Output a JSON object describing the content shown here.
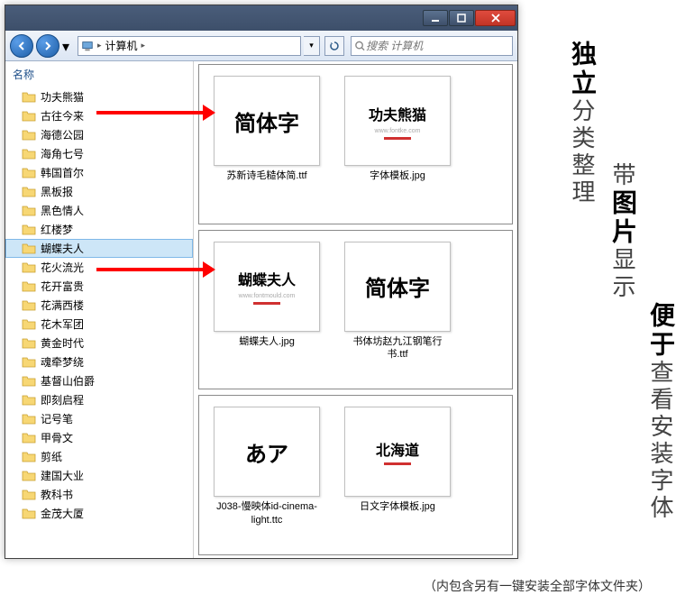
{
  "titlebar": {},
  "nav": {
    "address_icon": "computer-icon",
    "address_path": "计算机",
    "search_placeholder": "搜索 计算机"
  },
  "sidebar": {
    "header": "名称",
    "folders": [
      "功夫熊猫",
      "古往今来",
      "海德公园",
      "海角七号",
      "韩国首尔",
      "黑板报",
      "黑色情人",
      "红楼梦",
      "蝴蝶夫人",
      "花火流光",
      "花开富贵",
      "花满西楼",
      "花木军团",
      "黄金时代",
      "魂牵梦绕",
      "基督山伯爵",
      "即刻启程",
      "记号笔",
      "甲骨文",
      "剪纸",
      "建国大业",
      "教科书",
      "金茂大厦"
    ],
    "selected_index": 8
  },
  "panels": [
    {
      "thumbs": [
        {
          "main": "简体字",
          "sub": "",
          "label": "苏新诗毛糙体简.ttf"
        },
        {
          "main": "功夫熊猫",
          "sub": "www.fontke.com",
          "bar": true,
          "label": "字体模板.jpg",
          "small": true
        }
      ]
    },
    {
      "thumbs": [
        {
          "main": "蝴蝶夫人",
          "sub": "www.fontmould.com",
          "bar": true,
          "label": "蝴蝶夫人.jpg",
          "small": true
        },
        {
          "main": "简体字",
          "sub": "",
          "label": "书体坊赵九江钢笔行书.ttf"
        }
      ]
    },
    {
      "thumbs": [
        {
          "main": "あア",
          "sub": "",
          "label": "J038-慢映体id-cinema-light.ttc"
        },
        {
          "main": "北海道",
          "sub": "",
          "bar": true,
          "label": "日文字体模板.jpg",
          "small": true
        }
      ]
    }
  ],
  "side1": {
    "bold": "独立",
    "reg": "分类整理"
  },
  "side2": {
    "pre": "带",
    "bold": "图片",
    "reg": "显示"
  },
  "side3": {
    "bold": "便于",
    "reg": "查看安装字体"
  },
  "bottom": "（内包含另有一键安装全部字体文件夹）"
}
